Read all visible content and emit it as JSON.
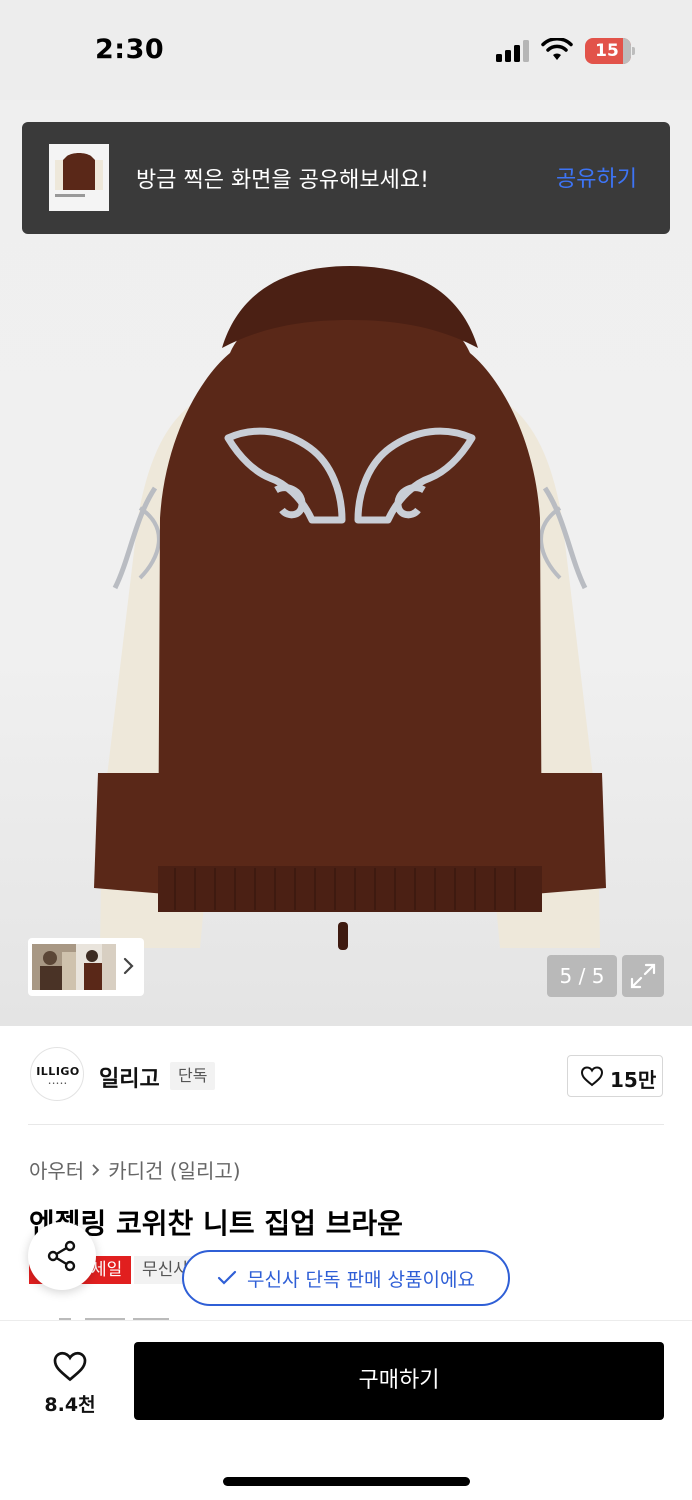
{
  "status_bar": {
    "time": "2:30",
    "battery": "15"
  },
  "toast": {
    "message": "방금 찍은 화면을 공유해보세요!",
    "action": "공유하기"
  },
  "gallery": {
    "counter": "5 / 5"
  },
  "brand": {
    "logo_text": "ILLIGO",
    "name": "일리고",
    "badge": "단독",
    "likes": "15만"
  },
  "breadcrumb": {
    "level1": "아우터",
    "separator": ">",
    "level2": "카디건 (일리고)"
  },
  "product": {
    "title": "엔젤링 코위찬 니트 집업 브라운",
    "tag_sale": "세일",
    "tag_musinsa": "무신사",
    "exclusive_notice": "무신사 단독 판매 상품이에요"
  },
  "bottom_bar": {
    "wish_count": "8.4천",
    "buy_label": "구매하기"
  },
  "colors": {
    "accent": "#2f5fd6",
    "sale": "#e11f1f",
    "sweater_brown": "#5a2818",
    "sweater_cream": "#efe9dc"
  },
  "icons": [
    "signal-icon",
    "wifi-icon",
    "battery-icon",
    "chevron-right-icon",
    "expand-icon",
    "heart-icon",
    "share-icon",
    "check-icon"
  ]
}
